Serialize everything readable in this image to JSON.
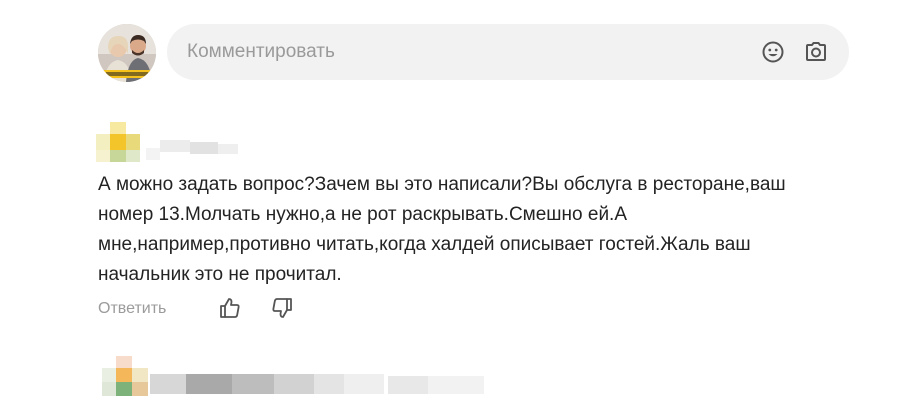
{
  "composer": {
    "placeholder": "Комментировать",
    "avatar_alt": "user-avatar",
    "icons": [
      "emoji-icon",
      "camera-icon"
    ]
  },
  "comment": {
    "author": "",
    "text": "А можно задать вопрос?Зачем вы это написали?Вы обслуга в ресторане,ваш\nномер 13.Молчать нужно,а не рот раскрывать.Смешно ей.А\nмне,например,противно читать,когда халдей описывает гостей.Жаль ваш\nначальник это не прочитал.",
    "reply_label": "Ответить",
    "icons": [
      "thumbs-up-icon",
      "thumbs-down-icon"
    ]
  },
  "colors": {
    "composer_bg": "#f2f2f2",
    "placeholder": "#9a9a9a",
    "text": "#232323",
    "muted": "#9b9b9b",
    "icon": "#555555"
  }
}
